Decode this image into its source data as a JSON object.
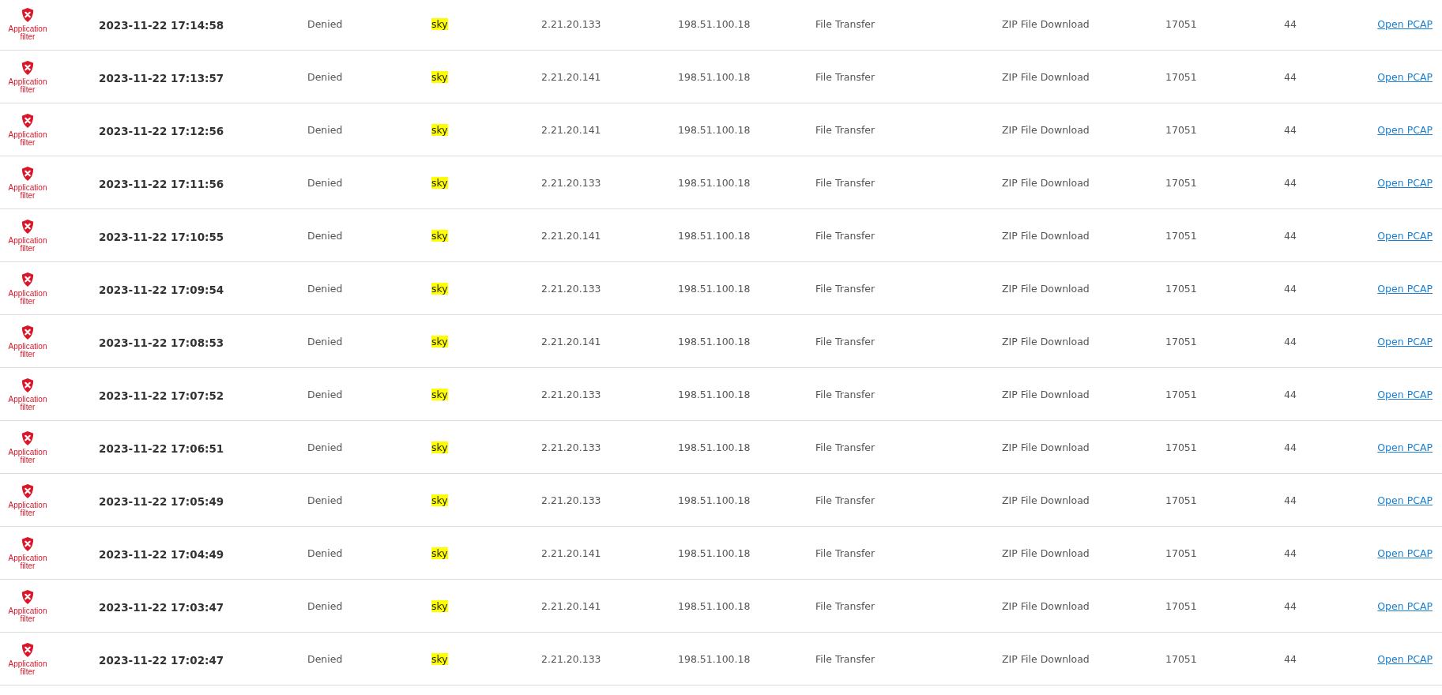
{
  "rows": [
    {
      "rule_type": "Application filter",
      "time": "2023-11-22 17:14:58",
      "action": "Denied",
      "user": "sky",
      "source_ip": "2.21.20.133",
      "destination_ip": "198.51.100.18",
      "category": "File Transfer",
      "application": "ZIP File Download",
      "column_9": "17051",
      "column_10": "44",
      "link": "Open PCAP"
    },
    {
      "rule_type": "Application filter",
      "time": "2023-11-22 17:13:57",
      "action": "Denied",
      "user": "sky",
      "source_ip": "2.21.20.141",
      "destination_ip": "198.51.100.18",
      "category": "File Transfer",
      "application": "ZIP File Download",
      "column_9": "17051",
      "column_10": "44",
      "link": "Open PCAP"
    },
    {
      "rule_type": "Application filter",
      "time": "2023-11-22 17:12:56",
      "action": "Denied",
      "user": "sky",
      "source_ip": "2.21.20.141",
      "destination_ip": "198.51.100.18",
      "category": "File Transfer",
      "application": "ZIP File Download",
      "column_9": "17051",
      "column_10": "44",
      "link": "Open PCAP"
    },
    {
      "rule_type": "Application filter",
      "time": "2023-11-22 17:11:56",
      "action": "Denied",
      "user": "sky",
      "source_ip": "2.21.20.133",
      "destination_ip": "198.51.100.18",
      "category": "File Transfer",
      "application": "ZIP File Download",
      "column_9": "17051",
      "column_10": "44",
      "link": "Open PCAP"
    },
    {
      "rule_type": "Application filter",
      "time": "2023-11-22 17:10:55",
      "action": "Denied",
      "user": "sky",
      "source_ip": "2.21.20.141",
      "destination_ip": "198.51.100.18",
      "category": "File Transfer",
      "application": "ZIP File Download",
      "column_9": "17051",
      "column_10": "44",
      "link": "Open PCAP"
    },
    {
      "rule_type": "Application filter",
      "time": "2023-11-22 17:09:54",
      "action": "Denied",
      "user": "sky",
      "source_ip": "2.21.20.133",
      "destination_ip": "198.51.100.18",
      "category": "File Transfer",
      "application": "ZIP File Download",
      "column_9": "17051",
      "column_10": "44",
      "link": "Open PCAP"
    },
    {
      "rule_type": "Application filter",
      "time": "2023-11-22 17:08:53",
      "action": "Denied",
      "user": "sky",
      "source_ip": "2.21.20.141",
      "destination_ip": "198.51.100.18",
      "category": "File Transfer",
      "application": "ZIP File Download",
      "column_9": "17051",
      "column_10": "44",
      "link": "Open PCAP"
    },
    {
      "rule_type": "Application filter",
      "time": "2023-11-22 17:07:52",
      "action": "Denied",
      "user": "sky",
      "source_ip": "2.21.20.133",
      "destination_ip": "198.51.100.18",
      "category": "File Transfer",
      "application": "ZIP File Download",
      "column_9": "17051",
      "column_10": "44",
      "link": "Open PCAP"
    },
    {
      "rule_type": "Application filter",
      "time": "2023-11-22 17:06:51",
      "action": "Denied",
      "user": "sky",
      "source_ip": "2.21.20.133",
      "destination_ip": "198.51.100.18",
      "category": "File Transfer",
      "application": "ZIP File Download",
      "column_9": "17051",
      "column_10": "44",
      "link": "Open PCAP"
    },
    {
      "rule_type": "Application filter",
      "time": "2023-11-22 17:05:49",
      "action": "Denied",
      "user": "sky",
      "source_ip": "2.21.20.133",
      "destination_ip": "198.51.100.18",
      "category": "File Transfer",
      "application": "ZIP File Download",
      "column_9": "17051",
      "column_10": "44",
      "link": "Open PCAP"
    },
    {
      "rule_type": "Application filter",
      "time": "2023-11-22 17:04:49",
      "action": "Denied",
      "user": "sky",
      "source_ip": "2.21.20.141",
      "destination_ip": "198.51.100.18",
      "category": "File Transfer",
      "application": "ZIP File Download",
      "column_9": "17051",
      "column_10": "44",
      "link": "Open PCAP"
    },
    {
      "rule_type": "Application filter",
      "time": "2023-11-22 17:03:47",
      "action": "Denied",
      "user": "sky",
      "source_ip": "2.21.20.141",
      "destination_ip": "198.51.100.18",
      "category": "File Transfer",
      "application": "ZIP File Download",
      "column_9": "17051",
      "column_10": "44",
      "link": "Open PCAP"
    },
    {
      "rule_type": "Application filter",
      "time": "2023-11-22 17:02:47",
      "action": "Denied",
      "user": "sky",
      "source_ip": "2.21.20.133",
      "destination_ip": "198.51.100.18",
      "category": "File Transfer",
      "application": "ZIP File Download",
      "column_9": "17051",
      "column_10": "44",
      "link": "Open PCAP"
    }
  ]
}
